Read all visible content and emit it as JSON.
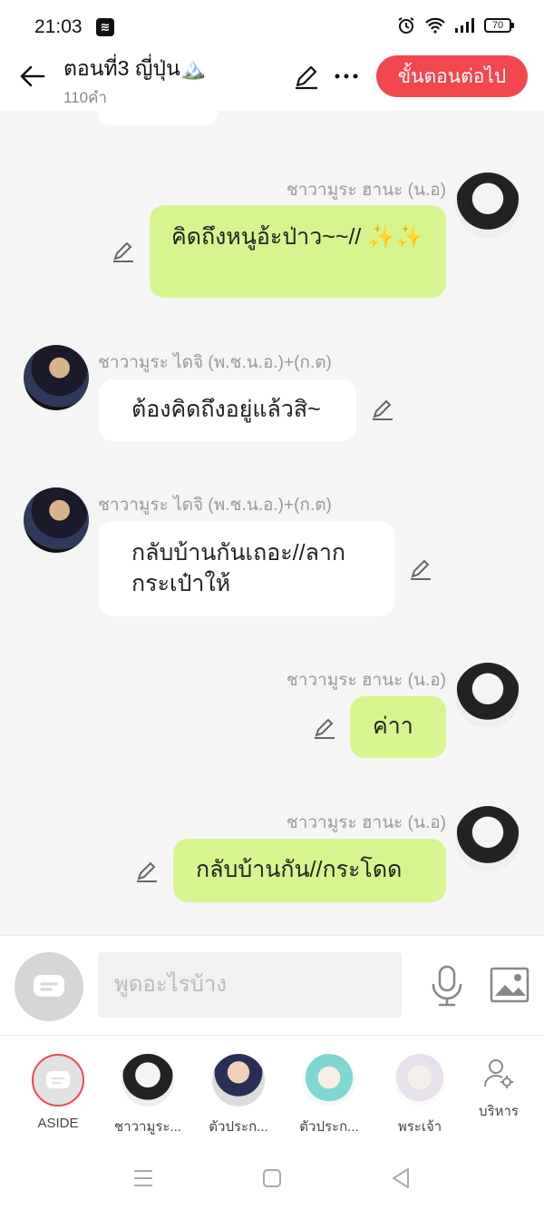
{
  "status": {
    "time": "21:03",
    "battery": "70"
  },
  "header": {
    "title": "ตอนที่3 ญี่ปุ่น🏔️",
    "subtitle": "110คำ",
    "next_label": "ขั้นตอนต่อไป"
  },
  "messages": [
    {
      "sender": "ชาวามูระ ฮานะ (น.อ)",
      "text": "คิดถึงหนูอ้ะป่าว~~// ✨✨",
      "side": "right"
    },
    {
      "sender": "ชาวามูระ ไดจิ (พ.ช.น.อ.)+(ก.ต)",
      "text": "ต้องคิดถึงอยู่แล้วสิ~",
      "side": "left"
    },
    {
      "sender": "ชาวามูระ ไดจิ (พ.ช.น.อ.)+(ก.ต)",
      "text": "กลับบ้านกันเถอะ//ลาก กระเป๋าให้",
      "side": "left"
    },
    {
      "sender": "ชาวามูระ ฮานะ (น.อ)",
      "text": "ค่าา",
      "side": "right"
    },
    {
      "sender": "ชาวามูระ ฮานะ (น.อ)",
      "text": "กลับบ้านกัน//กระโดด",
      "side": "right"
    }
  ],
  "input": {
    "placeholder": "พูดอะไรบ้าง"
  },
  "characters": [
    {
      "label": "ASIDE"
    },
    {
      "label": "ชาวามูระ..."
    },
    {
      "label": "ตัวประก..."
    },
    {
      "label": "ตัวประก..."
    },
    {
      "label": "พระเจ้า"
    }
  ],
  "manage_label": "บริหาร",
  "colors": {
    "accent": "#f2474e",
    "bubble_right": "#d7f58e",
    "bubble_left": "#ffffff",
    "background": "#f5f5f5"
  }
}
